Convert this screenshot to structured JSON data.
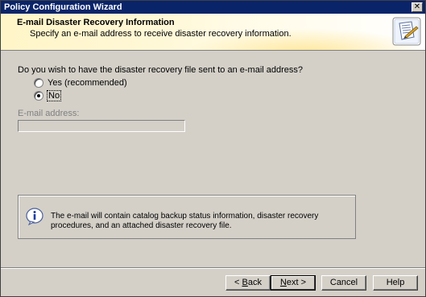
{
  "window": {
    "title": "Policy Configuration Wizard",
    "close_label": "✕"
  },
  "header": {
    "title": "E-mail Disaster Recovery Information",
    "subtitle": "Specify an e-mail address to receive disaster recovery information.",
    "icon": "wizard-document-icon"
  },
  "form": {
    "question": "Do you wish to have the disaster recovery file sent to an e-mail address?",
    "options": [
      {
        "label": "Yes (recommended)",
        "selected": false
      },
      {
        "label": "No",
        "selected": true
      }
    ],
    "email_label": "E-mail address:",
    "email_value": ""
  },
  "info": {
    "icon": "info-icon",
    "text": "The e-mail will contain catalog backup status information, disaster recovery procedures, and an attached disaster recovery file."
  },
  "buttons": {
    "back": {
      "prefix": "< ",
      "accel": "B",
      "rest": "ack"
    },
    "next": {
      "accel": "N",
      "rest": "ext >"
    },
    "cancel": "Cancel",
    "help": "Help"
  }
}
